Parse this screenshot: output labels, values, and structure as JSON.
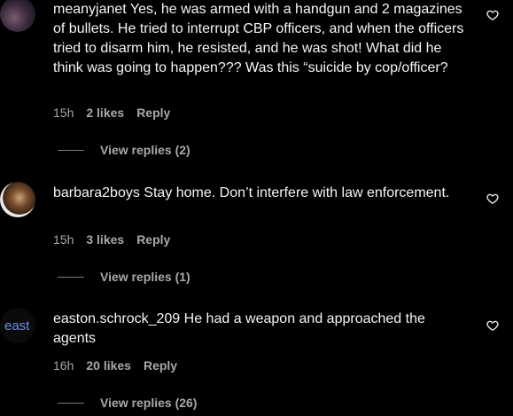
{
  "comments": [
    {
      "username": "meanyjanet",
      "text": "Yes, he was armed with a handgun and 2 magazines of bullets. He tried to interrupt CBP officers, and when the officers tried to disarm him, he resisted, and he was shot! What did he think was going to happen??? Was this “suicide by cop/officer?",
      "time": "15h",
      "likes": "2 likes",
      "reply": "Reply",
      "view_replies": "View replies (2)"
    },
    {
      "username": "barbara2boys",
      "text": "Stay home. Don’t interfere with law enforcement.",
      "time": "15h",
      "likes": "3 likes",
      "reply": "Reply",
      "view_replies": "View replies (1)"
    },
    {
      "username": "easton.schrock_209",
      "avatar_text": "east",
      "text": "He had a weapon and approached the agents",
      "time": "16h",
      "likes": "20 likes",
      "reply": "Reply",
      "view_replies": "View replies (26)"
    }
  ],
  "icons": {
    "like": "heart-icon"
  }
}
